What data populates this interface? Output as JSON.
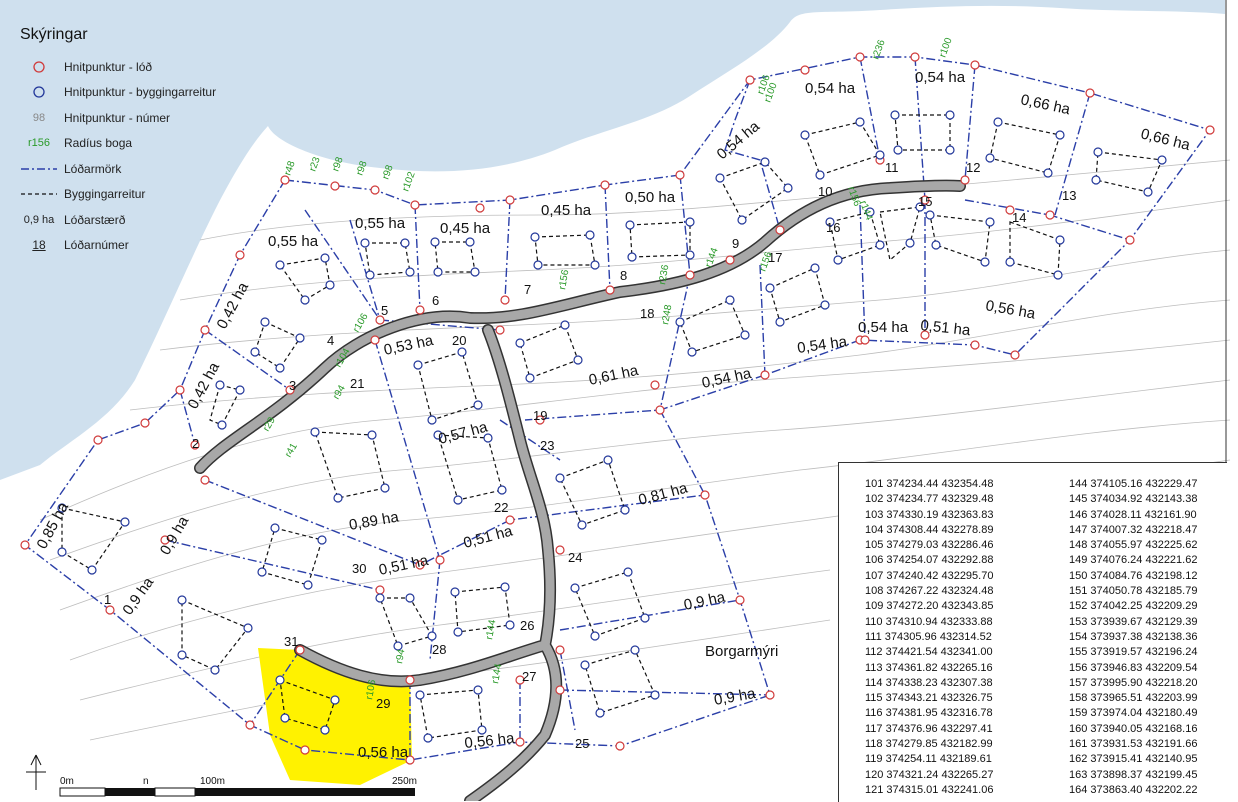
{
  "legend": {
    "title": "Skýringar",
    "items": [
      {
        "label": "Hnitpunktur - lóð",
        "symbol": "red-circle-icon"
      },
      {
        "label": "Hnitpunktur - byggingarreitur",
        "symbol": "blue-circle-icon"
      },
      {
        "label": "Hnitpunktur - númer",
        "symbol": "point-number-icon",
        "sample": "98"
      },
      {
        "label": "Radíus boga",
        "symbol": "arc-radius-icon",
        "sample": "r156"
      },
      {
        "label": "Lóðarmörk",
        "symbol": "dash-dot-line-icon"
      },
      {
        "label": "Byggingarreitur",
        "symbol": "dashed-line-icon"
      },
      {
        "label": "Lóðarstærð",
        "symbol": "lot-size-icon",
        "sample": "0,9 ha"
      },
      {
        "label": "Lóðarnúmer",
        "symbol": "lot-number-icon",
        "sample": "18"
      }
    ]
  },
  "place_label": "Borgarmýri",
  "scale_bar": {
    "labels": [
      "0m",
      "n",
      "100m",
      "250m"
    ]
  },
  "colors": {
    "sea": "#cfe0ee",
    "lot_boundary": "#2b3fa8",
    "building_area": "#111111",
    "lot_point": "#d03a3a",
    "building_point": "#22379a",
    "radius_label": "#2a9a2a",
    "road_fill": "#a8a8a8",
    "road_edge": "#333333",
    "highlight": "#fff200",
    "contour": "#bdbdbd"
  },
  "lot_sizes": [
    "0,55 ha",
    "0,45 ha",
    "0,45 ha",
    "0,50 ha",
    "0,54 ha",
    "0,54 ha",
    "0,66 ha",
    "0,66 ha",
    "0,54 ha",
    "0,55 ha",
    "0,42 ha",
    "0,42 ha",
    "0,53 ha",
    "0,57 ha",
    "0,61 ha",
    "0,54 ha",
    "0,54 ha",
    "0,54 ha",
    "0,51 ha",
    "0,56 ha",
    "0,85 ha",
    "0,9 ha",
    "0,9 ha",
    "0,89 ha",
    "0,51 ha",
    "0,51 ha",
    "0,81 ha",
    "0,9 ha",
    "0,9 ha",
    "0,56 ha",
    "0,56 ha"
  ],
  "lot_numbers": [
    "1",
    "2",
    "3",
    "4",
    "5",
    "6",
    "7",
    "8",
    "9",
    "10",
    "11",
    "12",
    "13",
    "14",
    "15",
    "16",
    "17",
    "18",
    "19",
    "20",
    "21",
    "22",
    "23",
    "24",
    "25",
    "26",
    "27",
    "28",
    "29",
    "30",
    "31"
  ],
  "radius_labels": [
    "r48",
    "r23",
    "r98",
    "r98",
    "r98",
    "r102",
    "r106",
    "r100",
    "r236",
    "r100",
    "r144",
    "r156",
    "r156",
    "r144",
    "r236",
    "r248",
    "r156",
    "r106",
    "r104",
    "r94",
    "r29",
    "r41",
    "r144",
    "r106",
    "r144",
    "r94"
  ],
  "coord_table": {
    "left": [
      {
        "id": "101",
        "x": "374234.44",
        "y": "432354.48"
      },
      {
        "id": "102",
        "x": "374234.77",
        "y": "432329.48"
      },
      {
        "id": "103",
        "x": "374330.19",
        "y": "432363.83"
      },
      {
        "id": "104",
        "x": "374308.44",
        "y": "432278.89"
      },
      {
        "id": "105",
        "x": "374279.03",
        "y": "432286.46"
      },
      {
        "id": "106",
        "x": "374254.07",
        "y": "432292.88"
      },
      {
        "id": "107",
        "x": "374240.42",
        "y": "432295.70"
      },
      {
        "id": "108",
        "x": "374267.22",
        "y": "432324.48"
      },
      {
        "id": "109",
        "x": "374272.20",
        "y": "432343.85"
      },
      {
        "id": "110",
        "x": "374310.94",
        "y": "432333.88"
      },
      {
        "id": "111",
        "x": "374305.96",
        "y": "432314.52"
      },
      {
        "id": "112",
        "x": "374421.54",
        "y": "432341.00"
      },
      {
        "id": "113",
        "x": "374361.82",
        "y": "432265.16"
      },
      {
        "id": "114",
        "x": "374338.23",
        "y": "432307.38"
      },
      {
        "id": "115",
        "x": "374343.21",
        "y": "432326.75"
      },
      {
        "id": "116",
        "x": "374381.95",
        "y": "432316.78"
      },
      {
        "id": "117",
        "x": "374376.96",
        "y": "432297.41"
      },
      {
        "id": "118",
        "x": "374279.85",
        "y": "432182.99"
      },
      {
        "id": "119",
        "x": "374254.11",
        "y": "432189.61"
      },
      {
        "id": "120",
        "x": "374321.24",
        "y": "432265.27"
      },
      {
        "id": "121",
        "x": "374315.01",
        "y": "432241.06"
      }
    ],
    "right": [
      {
        "id": "144",
        "x": "374105.16",
        "y": "432229.47"
      },
      {
        "id": "145",
        "x": "374034.92",
        "y": "432143.38"
      },
      {
        "id": "146",
        "x": "374028.11",
        "y": "432161.90"
      },
      {
        "id": "147",
        "x": "374007.32",
        "y": "432218.47"
      },
      {
        "id": "148",
        "x": "374055.97",
        "y": "432225.62"
      },
      {
        "id": "149",
        "x": "374076.24",
        "y": "432221.62"
      },
      {
        "id": "150",
        "x": "374084.76",
        "y": "432198.12"
      },
      {
        "id": "151",
        "x": "374050.78",
        "y": "432185.79"
      },
      {
        "id": "152",
        "x": "374042.25",
        "y": "432209.29"
      },
      {
        "id": "153",
        "x": "373939.67",
        "y": "432129.39"
      },
      {
        "id": "154",
        "x": "373937.38",
        "y": "432138.36"
      },
      {
        "id": "155",
        "x": "373919.57",
        "y": "432196.24"
      },
      {
        "id": "156",
        "x": "373946.83",
        "y": "432209.54"
      },
      {
        "id": "157",
        "x": "373995.90",
        "y": "432218.20"
      },
      {
        "id": "158",
        "x": "373965.51",
        "y": "432203.99"
      },
      {
        "id": "159",
        "x": "373974.04",
        "y": "432180.49"
      },
      {
        "id": "160",
        "x": "373940.05",
        "y": "432168.16"
      },
      {
        "id": "161",
        "x": "373931.53",
        "y": "432191.66"
      },
      {
        "id": "162",
        "x": "373915.41",
        "y": "432140.95"
      },
      {
        "id": "163",
        "x": "373898.37",
        "y": "432199.45"
      },
      {
        "id": "164",
        "x": "373863.40",
        "y": "432202.22"
      }
    ]
  }
}
